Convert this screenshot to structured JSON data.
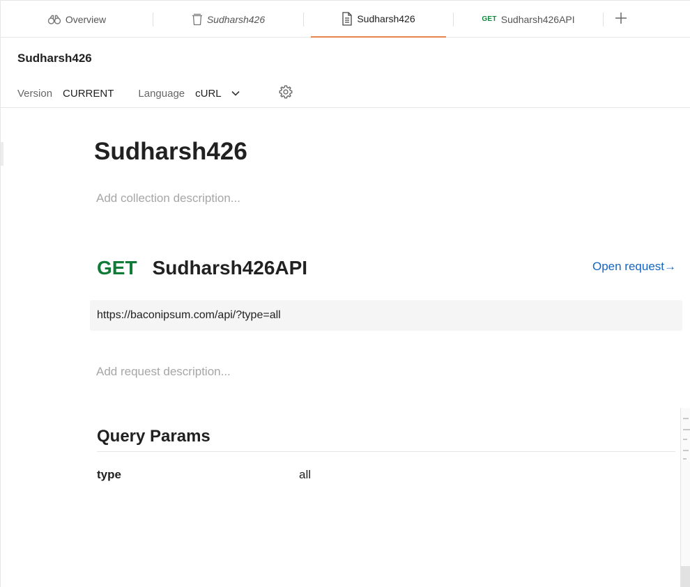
{
  "tabs": [
    {
      "label": "Overview",
      "icon": "binoculars-icon",
      "style": "normal"
    },
    {
      "label": "Sudharsh426",
      "icon": "trash-icon",
      "style": "italic"
    },
    {
      "label": "Sudharsh426",
      "icon": "document-icon",
      "style": "active"
    },
    {
      "label": "Sudharsh426API",
      "method": "GET",
      "style": "normal"
    }
  ],
  "header": {
    "title": "Sudharsh426",
    "version_label": "Version",
    "version_value": "CURRENT",
    "language_label": "Language",
    "language_value": "cURL"
  },
  "doc": {
    "title": "Sudharsh426",
    "collection_description_placeholder": "Add collection description...",
    "request": {
      "method": "GET",
      "name": "Sudharsh426API",
      "open_link": "Open request→",
      "url": "https://baconipsum.com/api/?type=all",
      "description_placeholder": "Add request description..."
    },
    "query_params": {
      "title": "Query Params",
      "rows": [
        {
          "key": "type",
          "value": "all"
        }
      ]
    }
  },
  "colors": {
    "accent": "#e8834e",
    "get_method": "#0f7b37",
    "link": "#1565c0",
    "placeholder": "#a6a6a6"
  }
}
